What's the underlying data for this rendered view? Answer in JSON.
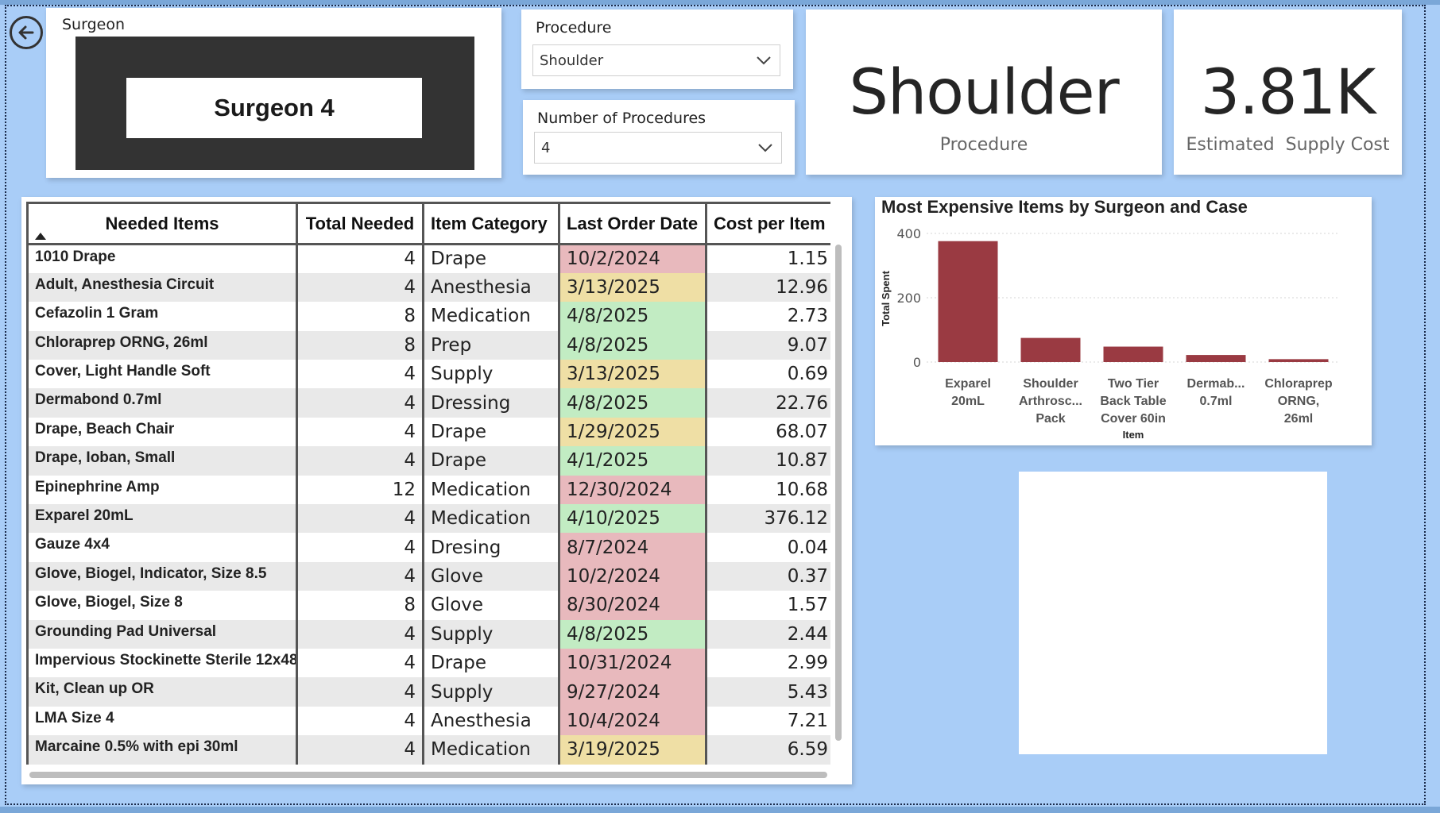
{
  "back_button": {
    "icon": "back-arrow-icon"
  },
  "surgeon_slicer": {
    "label": "Surgeon",
    "selected": "Surgeon 4"
  },
  "procedure_filter": {
    "label": "Procedure",
    "value": "Shoulder"
  },
  "number_filter": {
    "label": "Number of Procedures",
    "value": "4"
  },
  "kpi_procedure": {
    "value": "Shoulder",
    "label": "Procedure"
  },
  "kpi_cost": {
    "value": "3.81K",
    "label": "Estimated  Supply Cost"
  },
  "table": {
    "headers": [
      "Needed Items",
      "Total Needed",
      "Item Category",
      "Last Order Date",
      "Cost per Item"
    ],
    "rows": [
      {
        "item": "1010 Drape",
        "total": "4",
        "category": "Drape",
        "date": "10/2/2024",
        "status": "red",
        "cost": "1.15"
      },
      {
        "item": "Adult, Anesthesia Circuit",
        "total": "4",
        "category": "Anesthesia",
        "date": "3/13/2025",
        "status": "yellow",
        "cost": "12.96"
      },
      {
        "item": "Cefazolin 1 Gram",
        "total": "8",
        "category": "Medication",
        "date": "4/8/2025",
        "status": "green",
        "cost": "2.73"
      },
      {
        "item": "Chloraprep ORNG, 26ml",
        "total": "8",
        "category": "Prep",
        "date": "4/8/2025",
        "status": "green",
        "cost": "9.07"
      },
      {
        "item": "Cover, Light Handle Soft",
        "total": "4",
        "category": "Supply",
        "date": "3/13/2025",
        "status": "yellow",
        "cost": "0.69"
      },
      {
        "item": "Dermabond 0.7ml",
        "total": "4",
        "category": "Dressing",
        "date": "4/8/2025",
        "status": "green",
        "cost": "22.76"
      },
      {
        "item": "Drape, Beach Chair",
        "total": "4",
        "category": "Drape",
        "date": "1/29/2025",
        "status": "yellow",
        "cost": "68.07"
      },
      {
        "item": "Drape, Ioban, Small",
        "total": "4",
        "category": "Drape",
        "date": "4/1/2025",
        "status": "green",
        "cost": "10.87"
      },
      {
        "item": "Epinephrine Amp",
        "total": "12",
        "category": "Medication",
        "date": "12/30/2024",
        "status": "red",
        "cost": "10.68"
      },
      {
        "item": "Exparel 20mL",
        "total": "4",
        "category": "Medication",
        "date": "4/10/2025",
        "status": "green",
        "cost": "376.12"
      },
      {
        "item": "Gauze 4x4",
        "total": "4",
        "category": "Dresing",
        "date": "8/7/2024",
        "status": "red",
        "cost": "0.04"
      },
      {
        "item": "Glove, Biogel, Indicator, Size 8.5",
        "total": "4",
        "category": "Glove",
        "date": "10/2/2024",
        "status": "red",
        "cost": "0.37"
      },
      {
        "item": "Glove, Biogel, Size 8",
        "total": "8",
        "category": "Glove",
        "date": "8/30/2024",
        "status": "red",
        "cost": "1.57"
      },
      {
        "item": "Grounding Pad Universal",
        "total": "4",
        "category": "Supply",
        "date": "4/8/2025",
        "status": "green",
        "cost": "2.44"
      },
      {
        "item": "Impervious Stockinette Sterile 12x48",
        "total": "4",
        "category": "Drape",
        "date": "10/31/2024",
        "status": "red",
        "cost": "2.99"
      },
      {
        "item": "Kit, Clean up OR",
        "total": "4",
        "category": "Supply",
        "date": "9/27/2024",
        "status": "red",
        "cost": "5.43"
      },
      {
        "item": "LMA Size 4",
        "total": "4",
        "category": "Anesthesia",
        "date": "10/4/2024",
        "status": "red",
        "cost": "7.21"
      },
      {
        "item": "Marcaine 0.5% with epi 30ml",
        "total": "4",
        "category": "Medication",
        "date": "3/19/2025",
        "status": "yellow",
        "cost": "6.59"
      }
    ]
  },
  "colors": {
    "red": "#e8b9bd",
    "yellow": "#efdfa5",
    "green": "#c2ecc3",
    "bar": "#9a3a42",
    "background": "#a9cdf7"
  },
  "chart_data": {
    "type": "bar",
    "title": "Most Expensive Items by Surgeon and Case",
    "xlabel": "Item",
    "ylabel": "Total Spent",
    "categories": [
      [
        "Exparel",
        "20mL"
      ],
      [
        "Shoulder",
        "Arthrosc...",
        "Pack"
      ],
      [
        "Two Tier",
        "Back Table",
        "Cover 60in"
      ],
      [
        "Dermab...",
        "0.7ml"
      ],
      [
        "Chloraprep",
        "ORNG,",
        "26ml"
      ]
    ],
    "values": [
      376,
      75,
      48,
      22,
      9
    ],
    "yticks": [
      "0",
      "200",
      "400"
    ],
    "ylim": [
      0,
      400
    ],
    "grid": true
  }
}
